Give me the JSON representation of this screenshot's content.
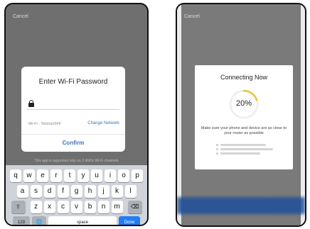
{
  "left_screen": {
    "cancel": "Cancel",
    "dialog": {
      "title": "Enter Wi-Fi Password",
      "wifi_label": "Wi-Fi : Telstra16FF",
      "change_network": "Change Network",
      "confirm": "Confirm"
    },
    "support_note": "This app is supported only on 2.4GHz Wi-Fi channels",
    "keyboard": {
      "row1": [
        "q",
        "w",
        "e",
        "r",
        "t",
        "y",
        "u",
        "i",
        "o",
        "p"
      ],
      "row2": [
        "a",
        "s",
        "d",
        "f",
        "g",
        "h",
        "j",
        "k",
        "l"
      ],
      "row3": [
        "z",
        "x",
        "c",
        "v",
        "b",
        "n",
        "m"
      ],
      "shift": "⇧",
      "delete": "⌫",
      "k123": "123",
      "globe": "🌐",
      "space": "space",
      "done": "Done"
    }
  },
  "right_screen": {
    "cancel": "Cancel",
    "dialog": {
      "title": "Connecting Now",
      "progress_label": "20%",
      "progress_fraction": 0.2,
      "hint": "Make sure your phone and device are as close to your router as possible"
    }
  },
  "colors": {
    "accent_blue": "#3f74b8",
    "progress_yellow": "#f2c230",
    "done_key": "#1f7ef5"
  }
}
